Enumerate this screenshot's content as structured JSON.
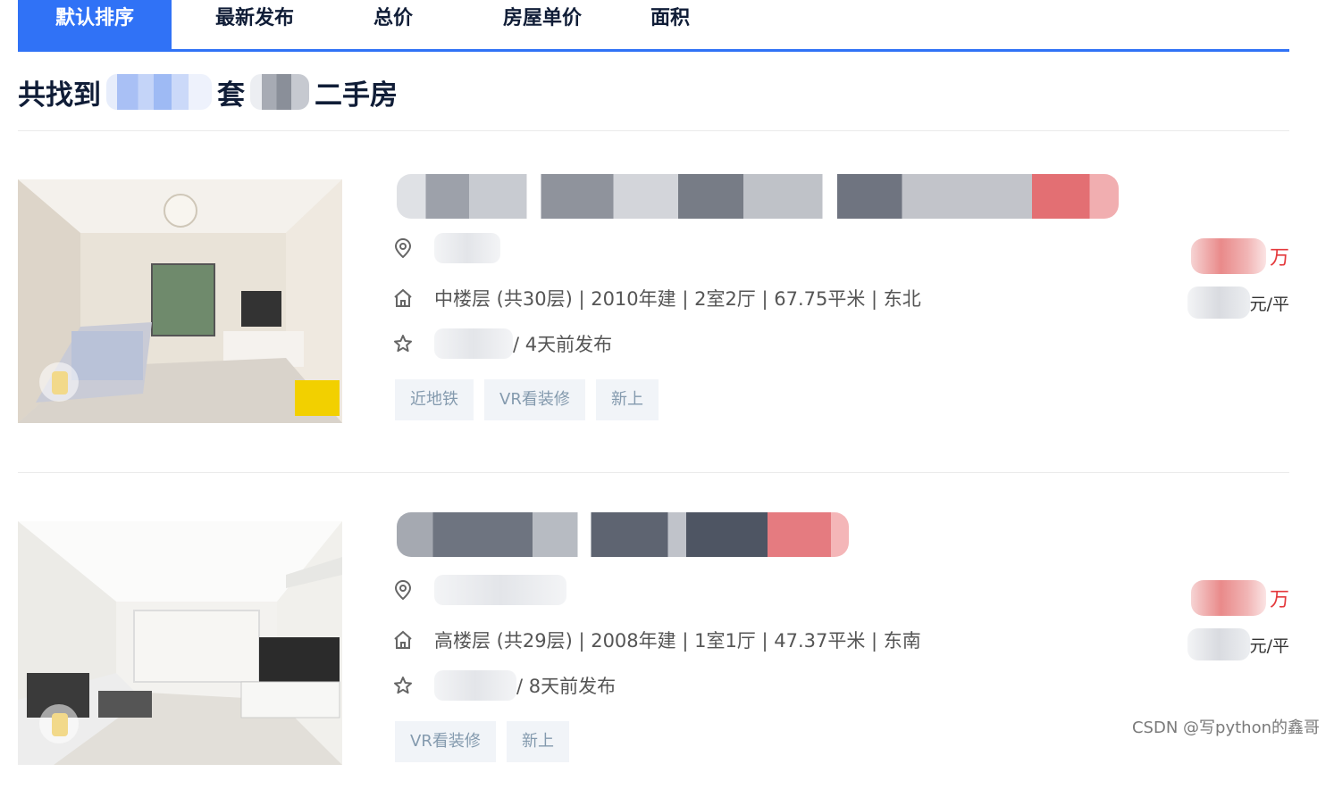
{
  "sort_tabs": [
    "默认排序",
    "最新发布",
    "总价",
    "房屋单价",
    "面积"
  ],
  "summary": {
    "prefix": "共找到",
    "middle": "套",
    "suffix": "二手房"
  },
  "listings": [
    {
      "info": "中楼层 (共30层) | 2010年建 | 2室2厅 | 67.75平米 | 东北",
      "follow": "/ 4天前发布",
      "tags": [
        "近地铁",
        "VR看装修",
        "新上"
      ],
      "total_unit": "万",
      "unit_price_unit": "元/平"
    },
    {
      "info": "高楼层 (共29层) | 2008年建 | 1室1厅 | 47.37平米 | 东南",
      "follow": "/ 8天前发布",
      "tags": [
        "VR看装修",
        "新上"
      ],
      "total_unit": "万",
      "unit_price_unit": "元/平"
    }
  ],
  "watermark": "CSDN @写python的鑫哥",
  "colors": {
    "accent": "#3072f6",
    "price": "#e4393c",
    "tag_bg": "#f1f4f8",
    "tag_text": "#849aae"
  },
  "icons": [
    "location-pin-icon",
    "house-icon",
    "star-icon"
  ]
}
